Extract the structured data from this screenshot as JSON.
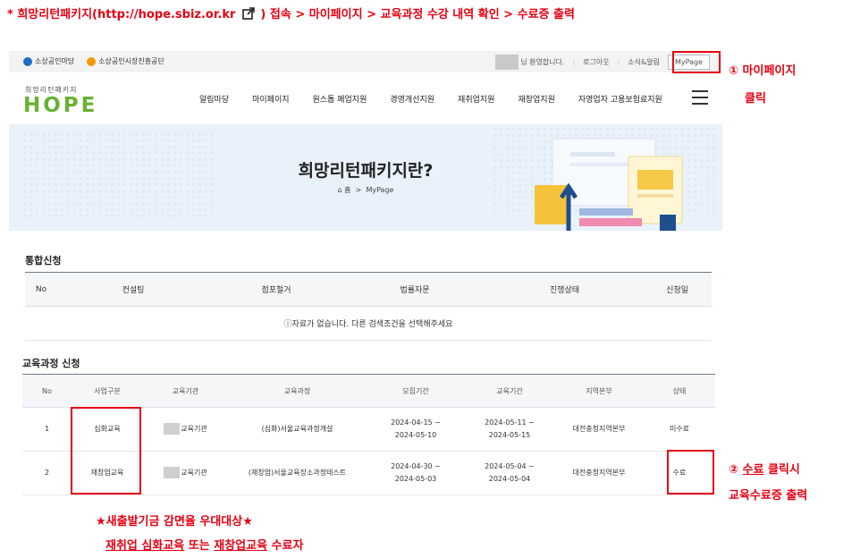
{
  "instruction": {
    "prefix": "* 희망리턴패키지(http://hope.sbiz.or.kr",
    "suffix": ") 접속 > 마이페이지 > 교육과정 수강 내역 확인 > 수료증 출력"
  },
  "utilbar": {
    "left_links": [
      "소상공인마당",
      "소상공인시장진흥공단"
    ],
    "welcome": "님 환영합니다.",
    "logout": "로그아웃",
    "news": "소식&알림",
    "mypage": "MyPage"
  },
  "header": {
    "logo_small": "희망리턴패키지",
    "logo_big": "HOPE",
    "nav": [
      "알림마당",
      "마이페이지",
      "원스톱 폐업지원",
      "경영개선지원",
      "재취업지원",
      "재창업지원",
      "자영업자 고용보험료지원"
    ]
  },
  "banner": {
    "title": "희망리턴패키지란?",
    "home": "홈",
    "current": "MyPage"
  },
  "integrated": {
    "title": "통합신청",
    "columns": [
      "No",
      "컨설팅",
      "점포철거",
      "법률자문",
      "진행상태",
      "신청일"
    ],
    "empty_message": "ⓘ자료가 없습니다. 다른 검색조건을 선택해주세요"
  },
  "education": {
    "title": "교육과정 신청",
    "columns": [
      "No",
      "사업구분",
      "교육기관",
      "교육과정",
      "모집기간",
      "교육기간",
      "지역본부",
      "상태"
    ],
    "rows": [
      {
        "no": "1",
        "type": "심화교육",
        "org": "교육기관",
        "course": "(심화)서울교육과정개설",
        "recruit_start": "2024-04-15 ~",
        "recruit_end": "2024-05-10",
        "edu_start": "2024-05-11 ~",
        "edu_end": "2024-05-15",
        "region": "대전충청지역본부",
        "status": "미수료"
      },
      {
        "no": "2",
        "type": "재창업교육",
        "org": "교육기관",
        "course": "(재창업)서울교육장소과정테스트",
        "recruit_start": "2024-04-30 ~",
        "recruit_end": "2024-05-03",
        "edu_start": "2024-05-04 ~",
        "edu_end": "2024-05-04",
        "region": "대전충청지역본부",
        "status": "수료"
      }
    ]
  },
  "annotations": {
    "step1_line1": "① 마이페이지",
    "step1_line2": "클릭",
    "step2_prefix": "② ",
    "step2_word": "수료",
    "step2_rest": " 클릭시",
    "step2_line2": "교육수료증 출력",
    "note_line1": "★새출발기금 감면율 우대대상★",
    "note_a": "재취업 심화교육",
    "note_b": " 또는 ",
    "note_c": "재창업교육",
    "note_d": " 수료자"
  },
  "colors": {
    "annotation_red": "#e60012",
    "hope_green": "#68b233",
    "link_blue": "#2e5aa6",
    "banner_bg": "#e9f1fa"
  }
}
